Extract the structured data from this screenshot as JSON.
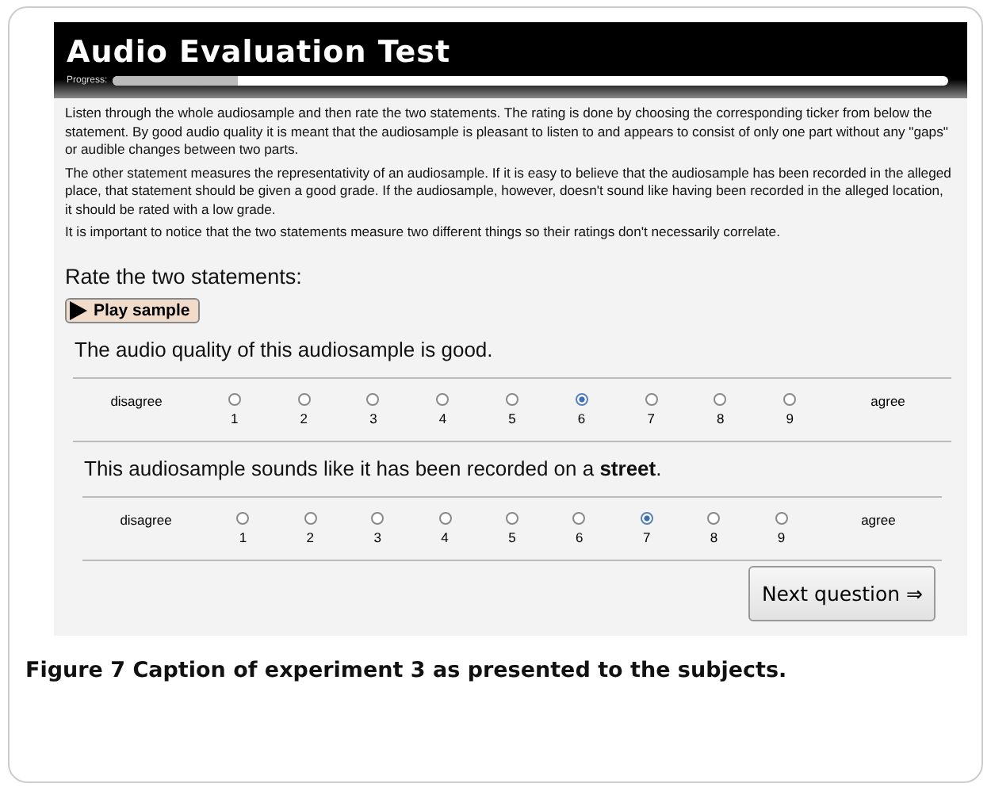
{
  "header": {
    "title": "Audio Evaluation Test",
    "progress_label": "Progress:",
    "progress": {
      "level": 0.15
    }
  },
  "instructions": [
    "Listen through the whole audiosample and then rate the two statements. The rating is done by choosing the corresponding ticker from below the statement. By good audio quality it is meant that the audiosample is pleasant to listen to and appears to consist of only one part without any \"gaps\" or audible changes between two parts.",
    "The other statement measures the representativity of an audiosample. If it is easy to believe that the audiosample has been recorded in the alleged place, that statement should be given a good grade. If the audiosample, however, doesn't sound like having been recorded in the alleged location, it should be rated with a low grade.",
    "It is important to notice that the two statements measure two different things so their ratings don't necessarily correlate."
  ],
  "rate_heading": "Rate the two statements:",
  "play_button": "Play sample",
  "questions": [
    {
      "statement": "The audio quality of this audiosample is good.",
      "low_label": "disagree",
      "high_label": "agree",
      "options": [
        {
          "label": "1",
          "selected": false
        },
        {
          "label": "2",
          "selected": false
        },
        {
          "label": "3",
          "selected": false
        },
        {
          "label": "4",
          "selected": false
        },
        {
          "label": "5",
          "selected": false
        },
        {
          "label": "6",
          "selected": true
        },
        {
          "label": "7",
          "selected": false
        },
        {
          "label": "8",
          "selected": false
        },
        {
          "label": "9",
          "selected": false
        }
      ]
    },
    {
      "statement": "This audiosample sounds like it has been recorded on a **street**.",
      "low_label": "disagree",
      "high_label": "agree",
      "options": [
        {
          "label": "1",
          "selected": false
        },
        {
          "label": "2",
          "selected": false
        },
        {
          "label": "3",
          "selected": false
        },
        {
          "label": "4",
          "selected": false
        },
        {
          "label": "5",
          "selected": false
        },
        {
          "label": "6",
          "selected": false
        },
        {
          "label": "7",
          "selected": true
        },
        {
          "label": "8",
          "selected": false
        },
        {
          "label": "9",
          "selected": false
        }
      ]
    }
  ],
  "next_button": "Next question ⇒",
  "caption": "**Figure 7** Caption of experiment 3 as presented to the subjects."
}
